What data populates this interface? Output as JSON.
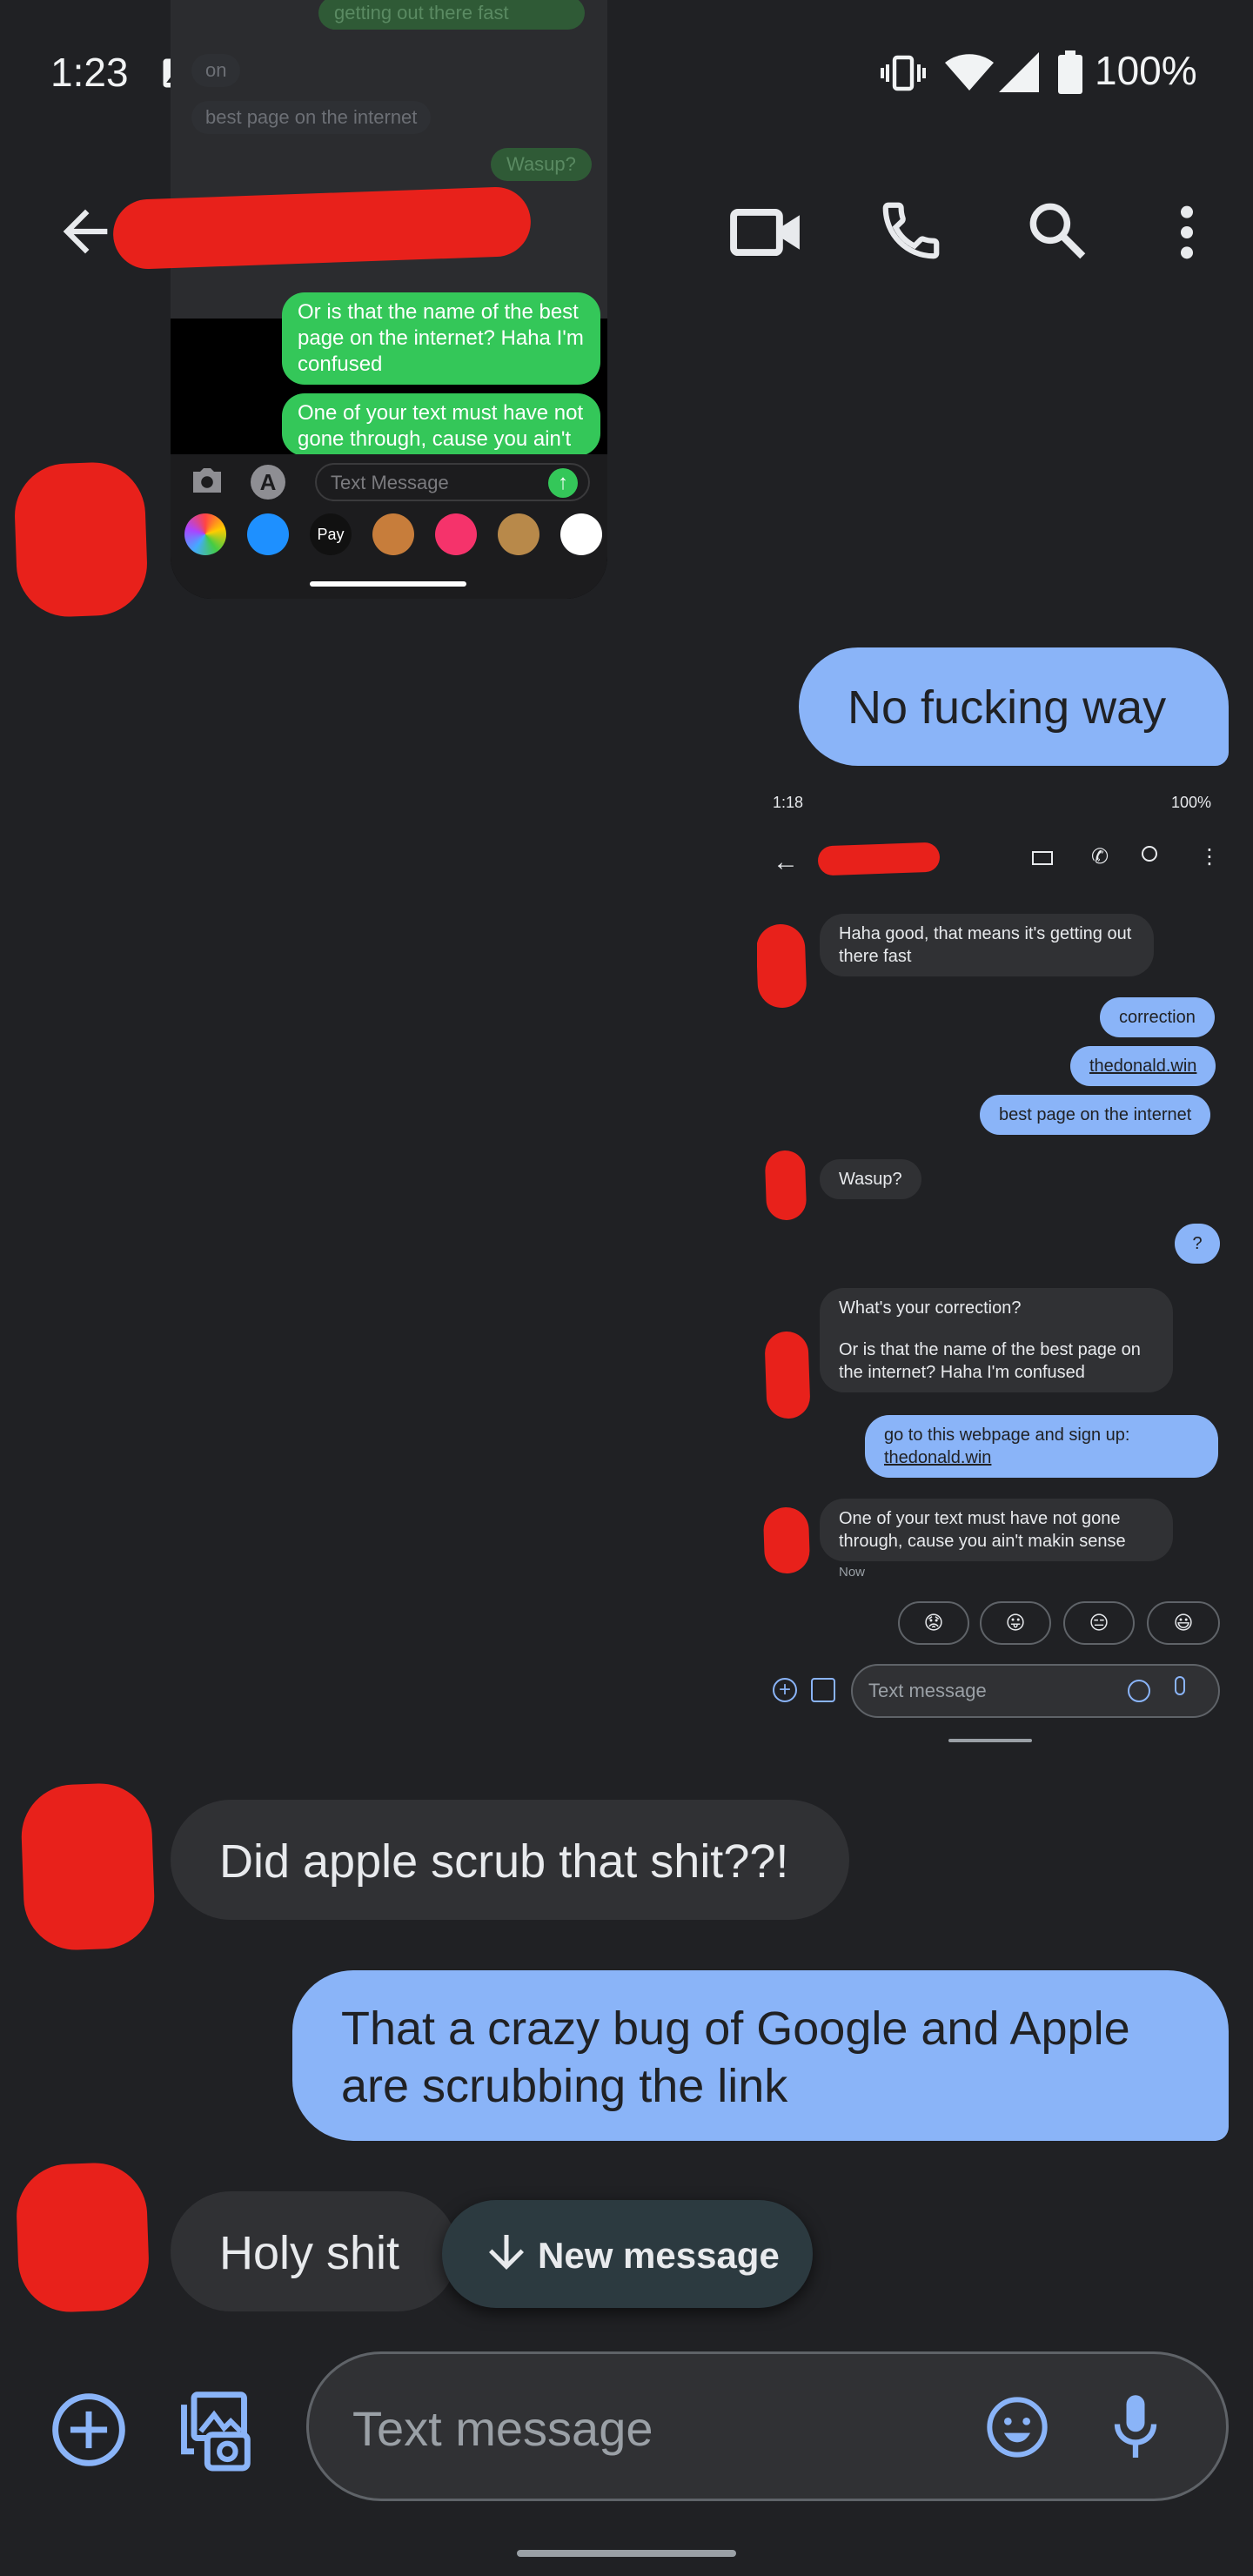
{
  "status_bar": {
    "time": "1:23",
    "battery": "100%",
    "icons": [
      "image-icon",
      "gmail-icon",
      "vibrate-icon",
      "wifi-icon",
      "signal-icon",
      "battery-icon"
    ]
  },
  "app_bar": {
    "back_icon": "arrow-left-icon",
    "actions": [
      "video-call-icon",
      "phone-icon",
      "search-icon",
      "more-vert-icon"
    ]
  },
  "ios_screenshot": {
    "top_bubbles": [
      "getting out there fast",
      "on",
      "best page on the internet",
      "Wasup?"
    ],
    "green_bubble_1": "Or is that the name of the best page on the internet? Haha I'm confused",
    "green_bubble_2": "One of your text must have not gone through, cause you ain't",
    "input_placeholder": "Text Message"
  },
  "messages": {
    "out_1": "No fucking way",
    "in_1": "Did apple scrub that shit??!",
    "out_2": "That a crazy bug of Google and Apple are scrubbing the link",
    "in_2": "Holy shit"
  },
  "android_screenshot": {
    "time": "1:18",
    "battery": "100%",
    "msg_in_1": "Haha good, that means it's getting out there fast",
    "msg_out_1": "correction",
    "msg_out_2": "thedonald.win",
    "msg_out_3": "best page on the internet",
    "msg_in_2": "Wasup?",
    "msg_out_4": "?",
    "msg_in_3a": "What's your correction?",
    "msg_in_3b": "Or is that the name of the best page on the internet? Haha I'm confused",
    "msg_out_5a": "go to this webpage and sign up:",
    "msg_out_5b": "thedonald.win",
    "msg_in_4": "One of your text must have not gone through, cause you ain't makin sense",
    "timestamp": "Now",
    "smart_replies": [
      "😟",
      "😛",
      "😑",
      "😃"
    ],
    "input_placeholder": "Text message"
  },
  "new_message_chip": {
    "label": "New message"
  },
  "compose": {
    "placeholder": "Text message"
  },
  "colors": {
    "background": "#202124",
    "incoming_bubble": "#303134",
    "outgoing_bubble": "#8ab4f8",
    "accent": "#8ab4f8",
    "ios_green": "#34c759",
    "redaction": "#e8211b"
  }
}
